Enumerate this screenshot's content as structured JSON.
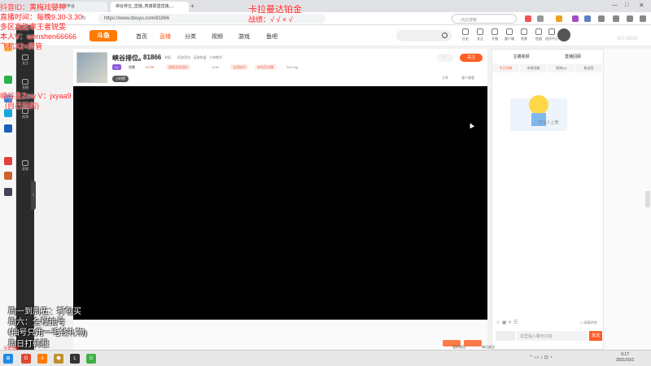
{
  "browser": {
    "tabs": [
      {
        "label": "斗鱼直播平台"
      },
      {
        "label": "峡谷排位_直播_英雄联盟直播_..."
      }
    ],
    "url": "https://www.douyu.com/81866",
    "search_placeholder": "点此搜索"
  },
  "header": {
    "logo": "斗鱼",
    "nav": [
      "首页",
      "直播",
      "分类",
      "视频",
      "游戏",
      "鱼吧"
    ],
    "icons": [
      "历史",
      "关注",
      "开播",
      "客户端",
      "鱼票",
      "鱼翅",
      "创作中心"
    ]
  },
  "sidebar": {
    "items": [
      "关注",
      "直播",
      "视频",
      "赛事"
    ]
  },
  "room": {
    "title": "峡谷排位。",
    "room_id": "81866",
    "report": "举报",
    "category": "网游竞技 · 英雄联盟 · 大神教学",
    "level_badge": "Lv.",
    "hot": "74799",
    "tag1": "国服龙虎组织",
    "count": "1234",
    "tag2": "全程抽号",
    "tag3": "体验官试播",
    "weight": "306.1kg",
    "rank": "小时榜",
    "follow": "关注",
    "share": "分享",
    "client": "客户端看",
    "bell": "♡"
  },
  "right_panel": {
    "tabs": [
      "主播视频",
      "直播回顾"
    ],
    "subtabs": [
      "今日贡献",
      "本周贡献",
      "贵宾(0)",
      "粉丝团"
    ],
    "empty_text": "暂无人上榜",
    "chat_placeholder": "这里输入聊天内容",
    "send": "发送",
    "watermark": "307-6929"
  },
  "below_video": {
    "buttons": [
      "我的钱包",
      "每日关注"
    ]
  },
  "overlays": {
    "line1": "抖音ID：黄梅戏婴神",
    "line2": "直播时间：每晚9.30-3.30",
    "line3": "多区高胜率王者锐雯",
    "line4": "本人V：wenshen66666",
    "line5": "飞机X2=房管",
    "top_red1": "卡拉曼达铂金",
    "top_red2": "战绩：√ √ × √",
    "mid1": "峡谷主Zow V：jxyaa9",
    "mid2": "(自己玩的)",
    "bottom1": "周一到周五：打包买",
    "bottom2": "周六：全程抽号",
    "bottom3": "(抽号只用一毛钱礼物)",
    "bottom4": "周日打韩服",
    "corner": "今日活跃"
  },
  "taskbar": {
    "time": "0:17",
    "date": "2021/10/1"
  }
}
